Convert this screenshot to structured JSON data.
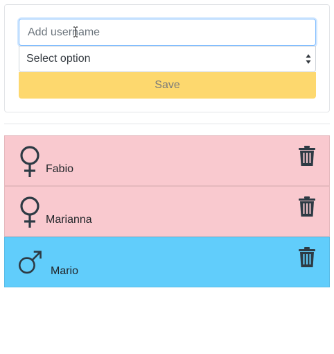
{
  "form": {
    "name_input": {
      "value": "",
      "placeholder": "Add username"
    },
    "gender_select": {
      "selected": "Select option"
    },
    "save_label": "Save"
  },
  "users": [
    {
      "name": "Fabio",
      "gender": "female",
      "icon": "venus-icon",
      "color": "#f9c9cf"
    },
    {
      "name": "Marianna",
      "gender": "female",
      "icon": "venus-icon",
      "color": "#f9c9cf"
    },
    {
      "name": "Mario",
      "gender": "male",
      "icon": "mars-icon",
      "color": "#61cdfb"
    }
  ],
  "colors": {
    "save_button": "#fdd86e",
    "female_row": "#f9c9cf",
    "male_row": "#61cdfb",
    "icon": "#2d3a44"
  },
  "icons": {
    "delete": "trash-icon"
  }
}
